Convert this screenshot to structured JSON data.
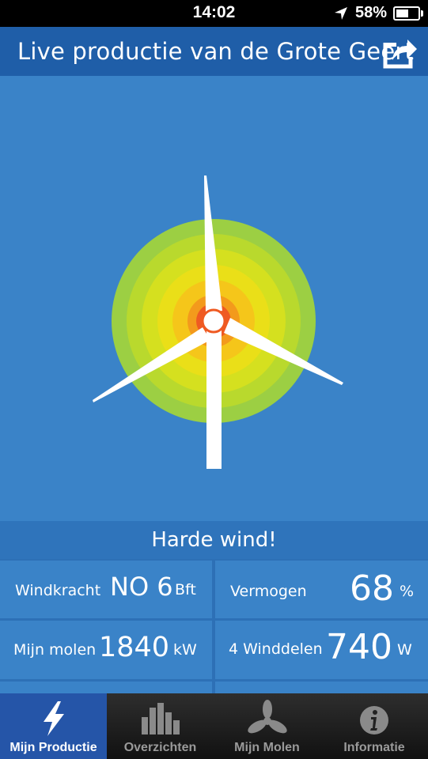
{
  "status_bar": {
    "time": "14:02",
    "battery": "58%",
    "battery_level": 0.58
  },
  "header": {
    "title": "Live productie van de Grote Geert"
  },
  "wind_status": "Harde wind!",
  "stats": {
    "windkracht": {
      "label": "Windkracht",
      "value": "NO 6",
      "unit": "Bft"
    },
    "vermogen": {
      "label": "Vermogen",
      "value": "68",
      "unit": "%"
    },
    "mijn_molen": {
      "label": "Mijn molen",
      "value": "1840",
      "unit": "kW"
    },
    "winddelen": {
      "label": "4 Winddelen",
      "value": "740",
      "unit": "W"
    }
  },
  "tabs": [
    {
      "label": "Mijn Productie",
      "icon": "bolt-icon",
      "active": true
    },
    {
      "label": "Overzichten",
      "icon": "bar-chart-icon",
      "active": false
    },
    {
      "label": "Mijn Molen",
      "icon": "propeller-icon",
      "active": false
    },
    {
      "label": "Informatie",
      "icon": "info-icon",
      "active": false
    }
  ],
  "colors": {
    "header": "#1f5ea8",
    "background": "#3a83c8",
    "active_tab": "#2555a8"
  }
}
